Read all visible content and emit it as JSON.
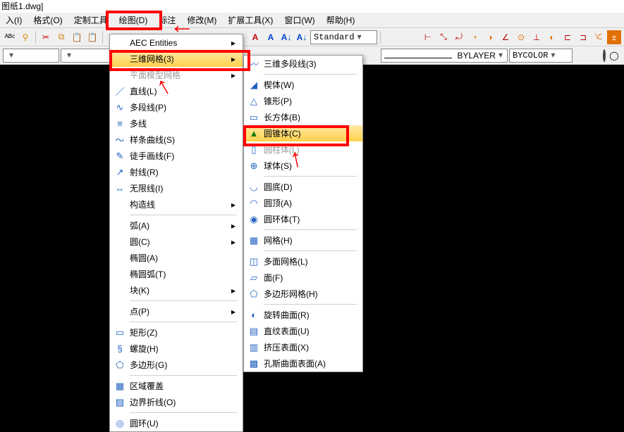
{
  "title": "图纸1.dwg]",
  "menubar": {
    "items": [
      "入(I)",
      "格式(O)",
      "定制工具",
      "绘图(D)",
      "标注",
      "修改(M)",
      "扩展工具(X)",
      "窗口(W)",
      "帮助(H)"
    ]
  },
  "toolbar_right_dropdown": "Standard",
  "layer_name": "BYLAYER",
  "color_name": "BYCOLOR",
  "drawmenu": {
    "items": [
      {
        "label": "AEC Entities",
        "arrow": true
      },
      {
        "label": "三维网格(3)",
        "arrow": true,
        "hover": true
      },
      {
        "label": "平面模型网格",
        "arrow": true,
        "mute": true
      },
      {
        "label": "直线(L)",
        "icon": "／"
      },
      {
        "label": "多段线(P)",
        "icon": "∿"
      },
      {
        "label": "多线",
        "icon": "≡"
      },
      {
        "label": "样条曲线(S)",
        "icon": "～"
      },
      {
        "label": "徒手画线(F)",
        "icon": "✎"
      },
      {
        "label": "射线(R)",
        "icon": "↗"
      },
      {
        "label": "无限线(I)",
        "icon": "↔"
      },
      {
        "label": "构造线",
        "arrow": true
      },
      {
        "sep": true
      },
      {
        "label": "弧(A)",
        "arrow": true
      },
      {
        "label": "圆(C)",
        "arrow": true
      },
      {
        "label": "椭圆(A)"
      },
      {
        "label": "椭圆弧(T)"
      },
      {
        "label": "块(K)",
        "arrow": true
      },
      {
        "sep": true
      },
      {
        "label": "点(P)",
        "arrow": true
      },
      {
        "sep": true
      },
      {
        "label": "矩形(Z)",
        "icon": "▭"
      },
      {
        "label": "螺旋(H)",
        "icon": "§"
      },
      {
        "label": "多边形(G)",
        "icon": "⬠"
      },
      {
        "sep": true
      },
      {
        "label": "区域覆盖",
        "icon": "▦"
      },
      {
        "label": "边界折线(O)",
        "icon": "▨"
      },
      {
        "sep": true
      },
      {
        "label": "圆环(U)",
        "icon": "◎"
      }
    ]
  },
  "submenu": {
    "items": [
      {
        "label": "三维多段线(3)",
        "icon": "〰"
      },
      {
        "sep": true
      },
      {
        "label": "楔体(W)",
        "icon": "◢"
      },
      {
        "label": "锥形(P)",
        "icon": "△"
      },
      {
        "label": "长方体(B)",
        "icon": "▭"
      },
      {
        "label": "圆锥体(C)",
        "icon": "▲",
        "hover": true
      },
      {
        "label": "圆柱体(L)",
        "icon": "▯",
        "mute": true
      },
      {
        "label": "球体(S)",
        "icon": "⊕"
      },
      {
        "sep": true
      },
      {
        "label": "圆底(D)",
        "icon": "◡"
      },
      {
        "label": "圆顶(A)",
        "icon": "◠"
      },
      {
        "label": "圆环体(T)",
        "icon": "◉"
      },
      {
        "sep": true
      },
      {
        "label": "网格(H)",
        "icon": "▦"
      },
      {
        "sep": true
      },
      {
        "label": "多面网格(L)",
        "icon": "◫"
      },
      {
        "label": "面(F)",
        "icon": "▱"
      },
      {
        "label": "多边形网格(H)",
        "icon": "⬠"
      },
      {
        "sep": true
      },
      {
        "label": "旋转曲面(R)",
        "icon": "◐"
      },
      {
        "label": "直纹表面(U)",
        "icon": "▤"
      },
      {
        "label": "挤压表面(X)",
        "icon": "▥"
      },
      {
        "label": "孔斯曲面表面(A)",
        "icon": "▩"
      }
    ]
  }
}
